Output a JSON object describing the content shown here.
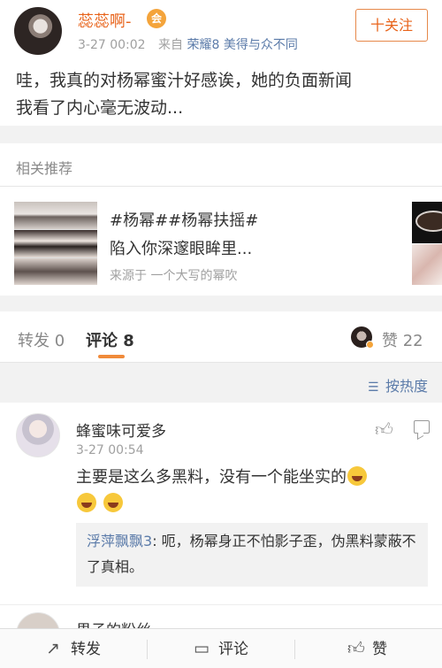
{
  "post": {
    "username": "蕊蕊啊-",
    "vip_badge": "会",
    "time": "3-27 00:02",
    "from_label": "来自",
    "source": "荣耀8 美得与众不同",
    "follow_label": "十关注",
    "content_line1": "哇，我真的对杨幂蜜汁好感诶，她的负面新闻",
    "content_line2": "我看了内心毫无波动..."
  },
  "recommend": {
    "title": "相关推荐",
    "tags": "#杨幂##杨幂扶摇#",
    "line": "陷入你深邃眼眸里...",
    "source": "来源于 一个大写的幂吹"
  },
  "tabs": {
    "repost": "转发 0",
    "comment": "评论 8",
    "like": "赞 22"
  },
  "sort": {
    "label": "按热度"
  },
  "comments": [
    {
      "name": "蜂蜜味可爱多",
      "time": "3-27 00:54",
      "text": "主要是这么多黑料，没有一个能坐实的",
      "reply_user": "浮萍飘飘3",
      "reply_text": ": 呃，杨幂身正不怕影子歪，伪黑料蒙蔽不了真相。"
    },
    {
      "name": "果子的粉丝"
    }
  ],
  "bottom_bar": {
    "repost": "转发",
    "comment": "评论",
    "like": "赞"
  },
  "colors": {
    "accent": "#e8631a",
    "link": "#5b7ba9",
    "underline": "#f08a3a"
  }
}
